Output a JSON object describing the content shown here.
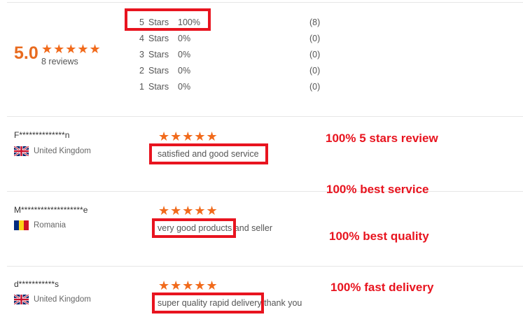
{
  "summary": {
    "score": "5.0",
    "stars": "★★★★★",
    "reviews_count": "8 reviews",
    "distribution": [
      {
        "stars": "5",
        "label": "Stars",
        "percent": "100%",
        "count": "(8)",
        "fill": 1.0
      },
      {
        "stars": "4",
        "label": "Stars",
        "percent": "0%",
        "count": "(0)",
        "fill": 0
      },
      {
        "stars": "3",
        "label": "Stars",
        "percent": "0%",
        "count": "(0)",
        "fill": 0
      },
      {
        "stars": "2",
        "label": "Stars",
        "percent": "0%",
        "count": "(0)",
        "fill": 0
      },
      {
        "stars": "1",
        "label": "Stars",
        "percent": "0%",
        "count": "(0)",
        "fill": 0
      }
    ]
  },
  "reviews": [
    {
      "name": "F**************n",
      "country": "United Kingdom",
      "flag": "uk-flag-icon",
      "stars": "★★★★★",
      "rating": 5,
      "text": "satisfied and good service"
    },
    {
      "name": "M*******************e",
      "country": "Romania",
      "flag": "romania-flag-icon",
      "stars": "★★★★★",
      "rating": 5,
      "text": "very good products and seller"
    },
    {
      "name": "d***********s",
      "country": "United Kingdom",
      "flag": "uk-flag-icon",
      "stars": "★★★★★",
      "rating": 5,
      "text": "super quality rapid delivery thank you"
    }
  ],
  "promos": [
    "100% 5 stars review",
    "100% best service",
    "100% best quality",
    "100% fast delivery"
  ],
  "colors": {
    "star": "#f16a1b",
    "score": "#e86b1f",
    "highlight": "#e8141f",
    "promo_text": "#e8141f"
  }
}
